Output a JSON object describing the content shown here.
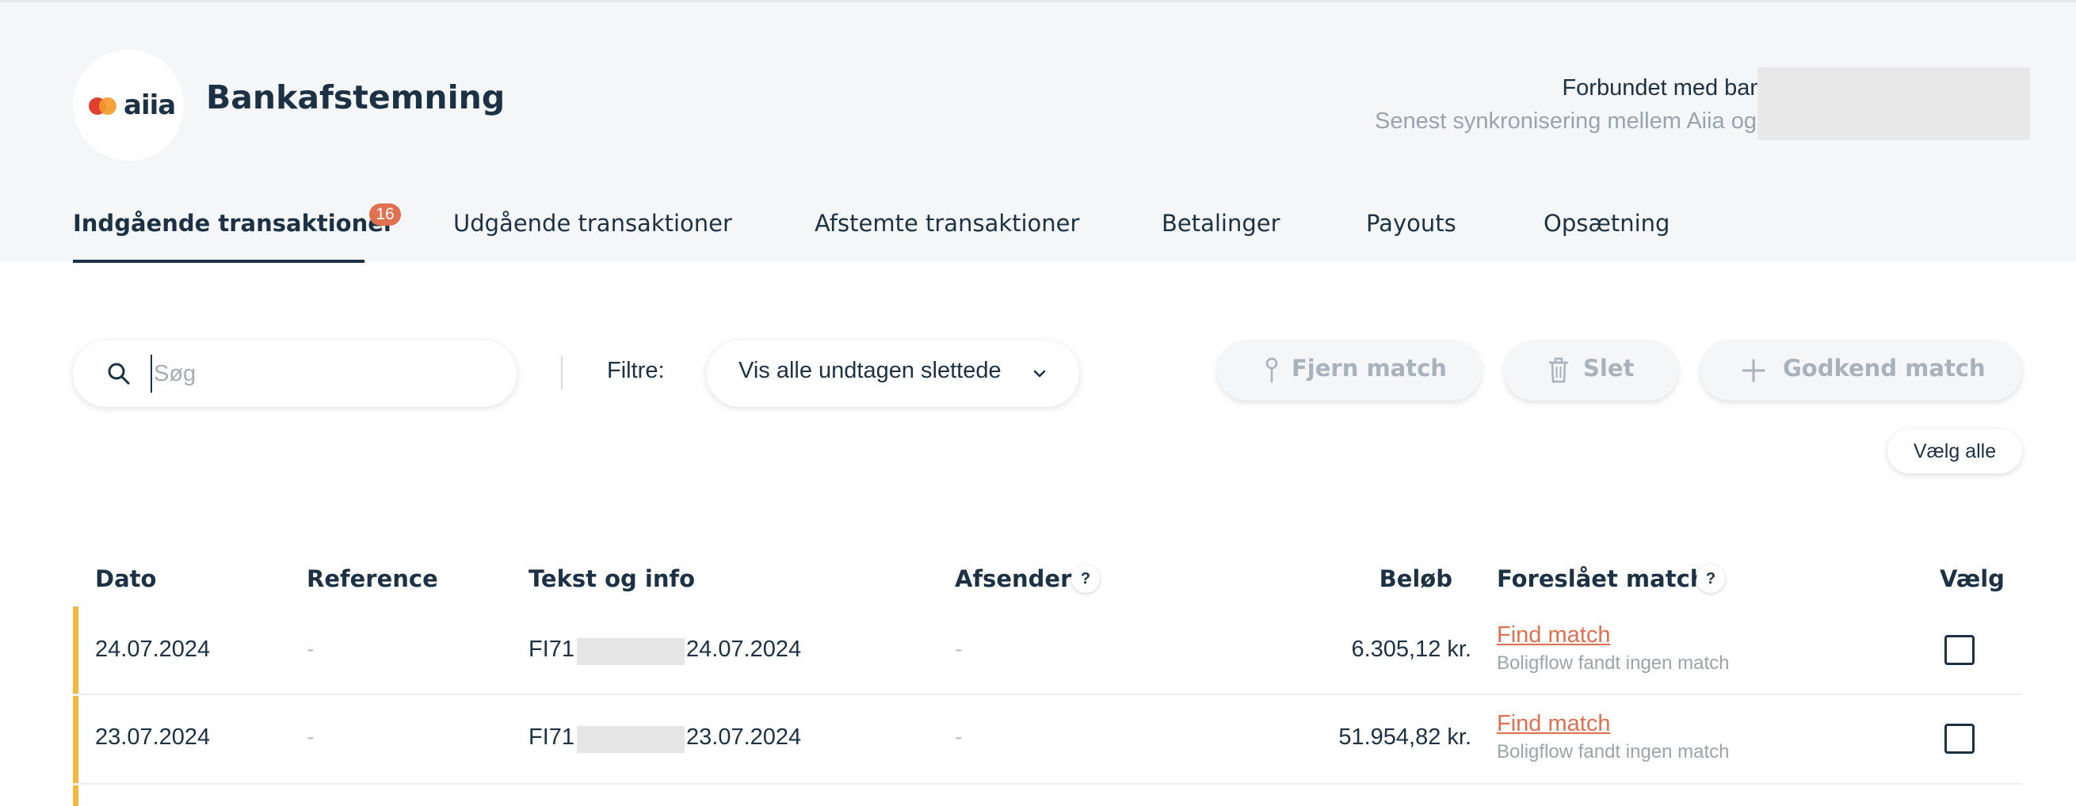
{
  "app": {
    "logo_text": "aiia",
    "title": "Bankafstemning"
  },
  "connection": {
    "line1": "Forbundet med bankkonto",
    "line2": "Senest synkronisering mellem Aiia og"
  },
  "tabs": [
    {
      "label": "Indgående transaktioner",
      "badge": "16"
    },
    {
      "label": "Udgående transaktioner"
    },
    {
      "label": "Afstemte transaktioner"
    },
    {
      "label": "Betalinger"
    },
    {
      "label": "Payouts"
    },
    {
      "label": "Opsætning"
    }
  ],
  "toolbar": {
    "search_placeholder": "Søg",
    "filter_label": "Filtre:",
    "filter_value": "Vis alle undtagen slettede",
    "remove_match": "Fjern match",
    "delete": "Slet",
    "approve_match": "Godkend match",
    "select_all": "Vælg alle"
  },
  "table": {
    "headers": {
      "date": "Dato",
      "reference": "Reference",
      "text": "Tekst og info",
      "sender": "Afsender",
      "amount": "Beløb",
      "suggested": "Foreslået match",
      "select": "Vælg"
    },
    "help_icon": "?",
    "rows": [
      {
        "date": "24.07.2024",
        "reference": "-",
        "text_prefix": "FI71",
        "text_suffix": "24.07.2024",
        "sender": "-",
        "amount": "6.305,12 kr.",
        "match_link": "Find match",
        "match_note": "Boligflow fandt ingen match"
      },
      {
        "date": "23.07.2024",
        "reference": "-",
        "text_prefix": "FI71",
        "text_suffix": "23.07.2024",
        "sender": "-",
        "amount": "51.954,82 kr.",
        "match_link": "Find match",
        "match_note": "Boligflow fandt ingen match"
      }
    ]
  },
  "colors": {
    "navy": "#1c3244",
    "accent_orange": "#e07050",
    "row_accent": "#f1b940",
    "header_bg": "#f4f6f8"
  }
}
